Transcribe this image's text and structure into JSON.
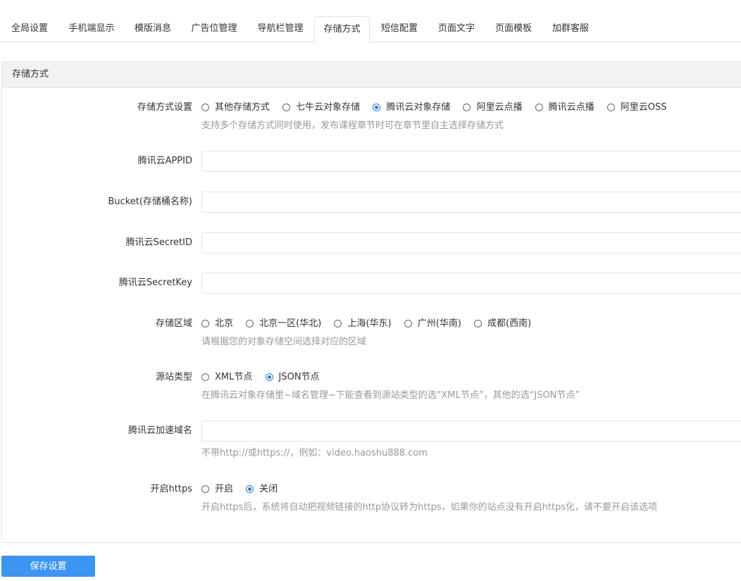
{
  "tabs": [
    {
      "label": "全局设置"
    },
    {
      "label": "手机端显示"
    },
    {
      "label": "模版消息"
    },
    {
      "label": "广告位管理"
    },
    {
      "label": "导航栏管理"
    },
    {
      "label": "存储方式"
    },
    {
      "label": "短信配置"
    },
    {
      "label": "页面文字"
    },
    {
      "label": "页面模板"
    },
    {
      "label": "加群客服"
    }
  ],
  "active_tab": "存储方式",
  "panel": {
    "title": "存储方式"
  },
  "form": {
    "storage": {
      "label": "存储方式设置",
      "options": [
        "其他存储方式",
        "七牛云对象存储",
        "腾讯云对象存储",
        "阿里云点播",
        "腾讯云点播",
        "阿里云OSS"
      ],
      "selected": "腾讯云对象存储",
      "hint": "支持多个存储方式同时使用，发布课程章节时可在章节里自主选择存储方式"
    },
    "appid": {
      "label": "腾讯云APPID",
      "value": ""
    },
    "bucket": {
      "label": "Bucket(存储桶名称)",
      "value": ""
    },
    "secret_id": {
      "label": "腾讯云SecretID",
      "value": ""
    },
    "secret_key": {
      "label": "腾讯云SecretKey",
      "value": ""
    },
    "region": {
      "label": "存储区域",
      "options": [
        "北京",
        "北京一区(华北)",
        "上海(华东)",
        "广州(华南)",
        "成都(西南)"
      ],
      "selected": "",
      "hint": "请根据您的对象存储空间选择对应的区域"
    },
    "origin_type": {
      "label": "源站类型",
      "options": [
        "XML节点",
        "JSON节点"
      ],
      "selected": "JSON节点",
      "hint": "在腾讯云对象存储里~域名管理~下能查看到源站类型的选“XML节点”，其他的选“JSON节点”"
    },
    "domain": {
      "label": "腾讯云加速域名",
      "value": "",
      "hint": "不带http://或https://，例如：video.haoshu888.com"
    },
    "https": {
      "label": "开启https",
      "options": [
        "开启",
        "关闭"
      ],
      "selected": "关闭",
      "hint": "开启https后，系统将自动把视频链接的http协议转为https，如果你的站点没有开启https化，请不要开启该选项"
    }
  },
  "save_button": "保存设置",
  "colors": {
    "accent": "#1e7be6",
    "button": "#3d95f2"
  }
}
